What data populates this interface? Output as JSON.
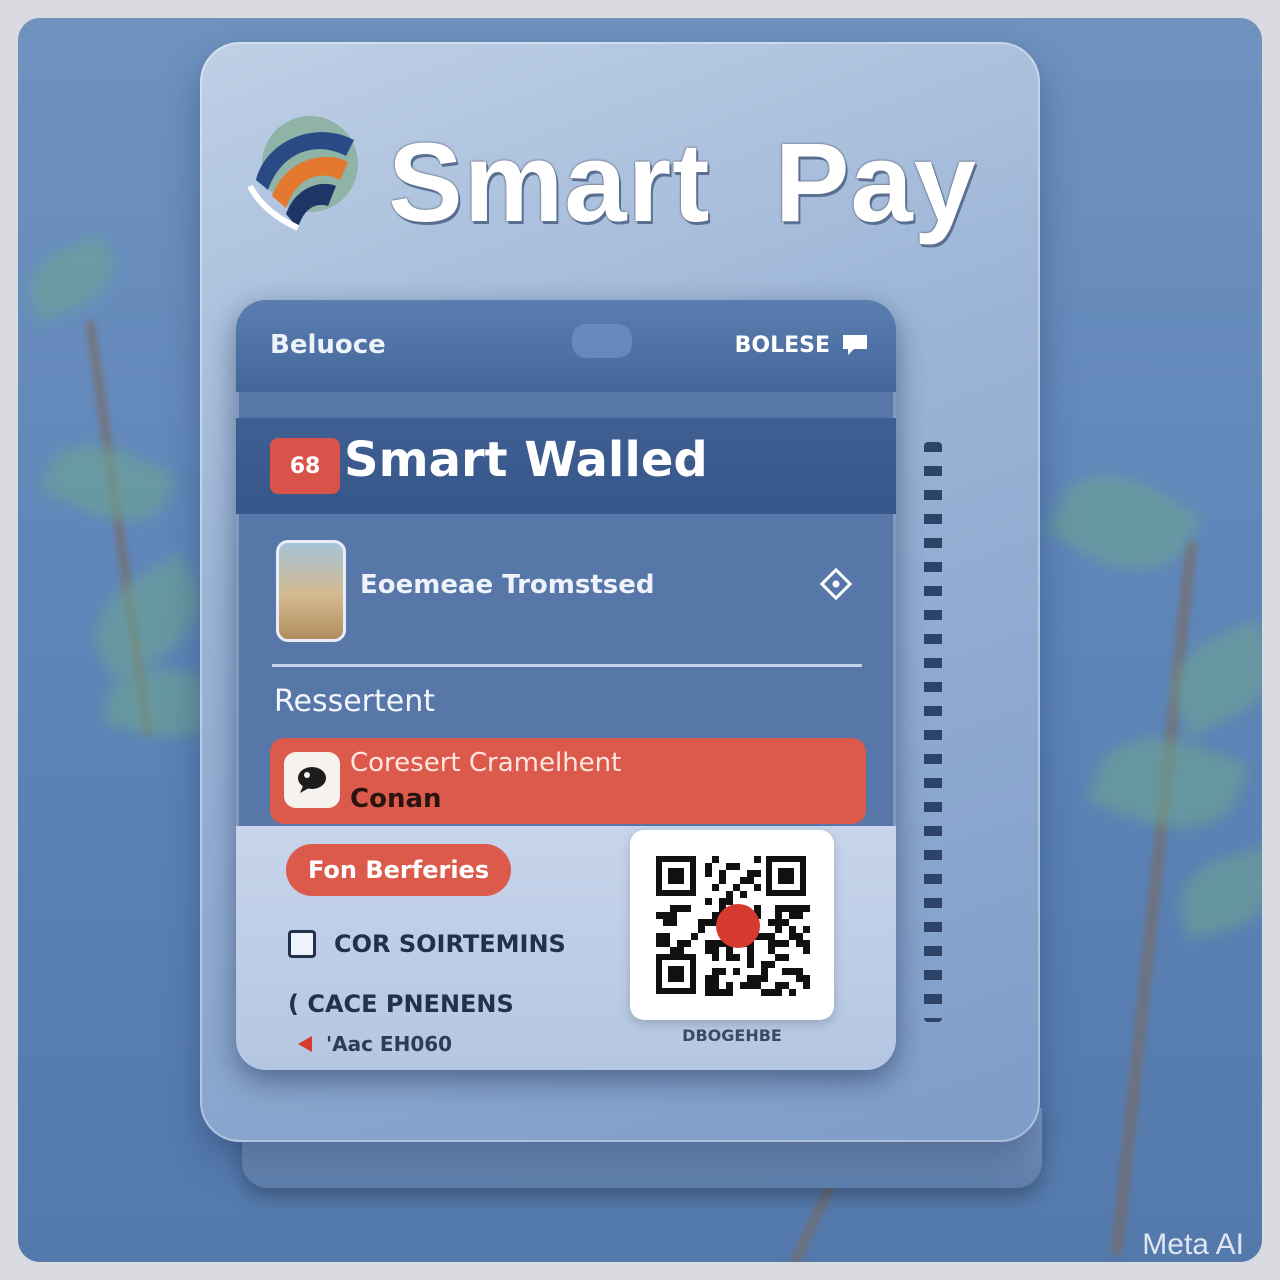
{
  "app": {
    "brand_name": "Smart  Pay"
  },
  "header": {
    "balance_label": "Beluoce",
    "right_label": "BOLESE",
    "right_icon": "chat-icon"
  },
  "wallet": {
    "badge": "68",
    "title": "Smart Walled"
  },
  "transaction": {
    "label": "Eoemeae Tromstsed",
    "action_icon": "diamond-navigate-icon"
  },
  "section": {
    "label": "Ressertent"
  },
  "promo": {
    "line1": "Coresert Cramelhent",
    "line2": "Conan",
    "icon": "chat-bubble-icon"
  },
  "actions": {
    "pill_label": "Fon Berferies",
    "checkbox_label": "COR SOIRTEMINS",
    "secondary_label": "( CACE PNENENS",
    "back_label": "'Aac EH060"
  },
  "qr": {
    "caption": "DBOGEHBE"
  },
  "watermark": "Meta AI",
  "colors": {
    "accent_red": "#dc5a4c",
    "primary_blue": "#3f5f93",
    "panel_light": "#bfd0e6"
  }
}
